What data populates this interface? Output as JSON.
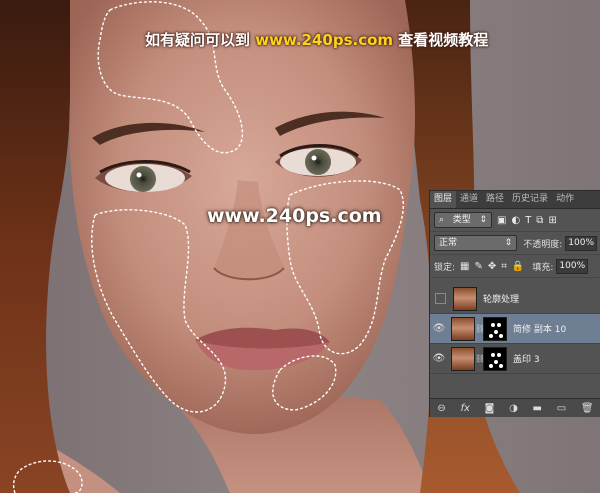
{
  "overlay": {
    "caption_prefix": "如有疑问可以到",
    "caption_url": "www.240ps.com",
    "caption_suffix": "查看视频教程",
    "watermark": "www.240ps.com"
  },
  "layers_panel": {
    "tabs": [
      "图层",
      "通道",
      "路径",
      "历史记录",
      "动作"
    ],
    "filter": {
      "label": "类型",
      "icon": "search-icon"
    },
    "blend_mode": "正常",
    "opacity_label": "不透明度:",
    "opacity_value": "100%",
    "lock_label": "锁定:",
    "fill_label": "填充:",
    "fill_value": "100%",
    "layers": [
      {
        "name": "轮廓处理",
        "visible": false,
        "has_mask": false
      },
      {
        "name": "简修 副本 10",
        "visible": true,
        "has_mask": true,
        "selected": true
      },
      {
        "name": "盖印 3",
        "visible": true,
        "has_mask": true
      }
    ]
  }
}
